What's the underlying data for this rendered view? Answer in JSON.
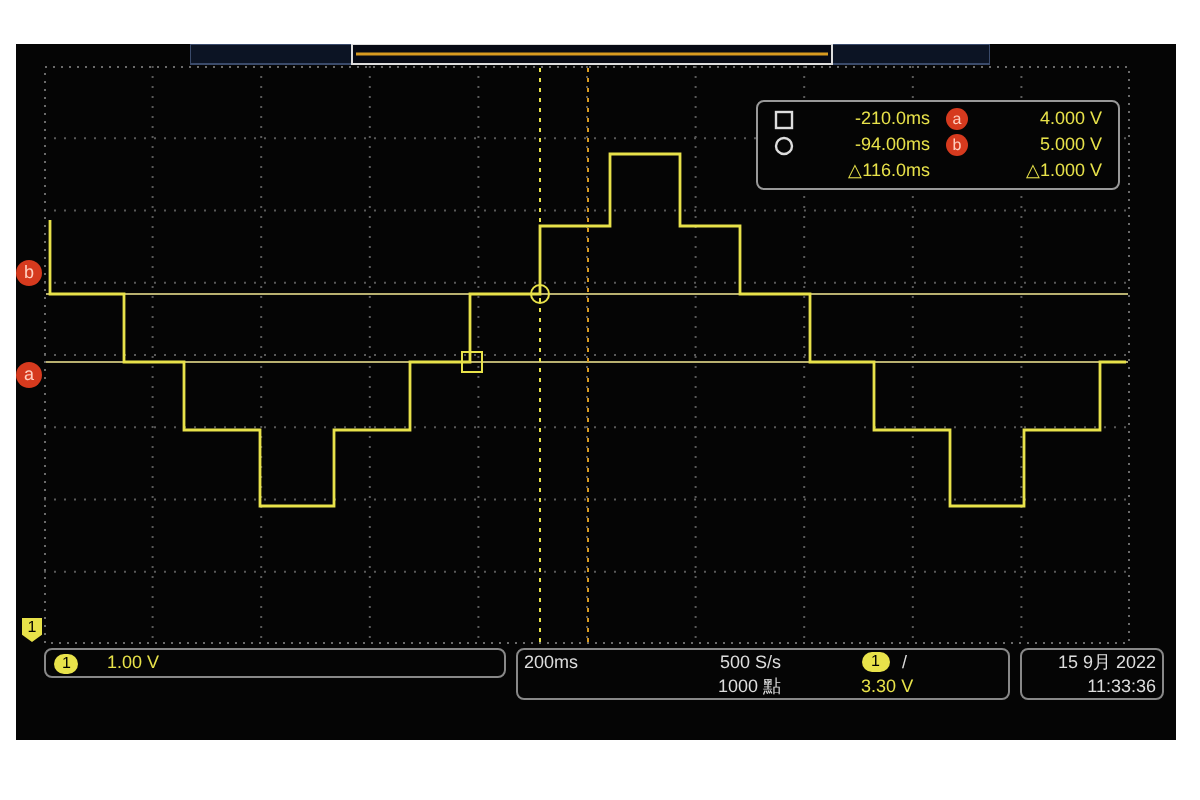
{
  "level_markers": [
    {
      "label": "b",
      "kind": "ref"
    },
    {
      "label": "a",
      "kind": "ref"
    }
  ],
  "channel_marker": {
    "label": "1"
  },
  "cursor_readout": {
    "rows": [
      {
        "kind": "square",
        "time": "-210.0ms",
        "marker": "a",
        "value": "4.000 V"
      },
      {
        "kind": "circle",
        "time": "-94.00ms",
        "marker": "b",
        "value": "5.000 V"
      }
    ],
    "delta_time": "△116.0ms",
    "delta_value": "△1.000 V"
  },
  "channel_box": {
    "channel": "1",
    "scale": "1.00 V"
  },
  "horizontal_box": {
    "time_scale": "200ms",
    "sample_rate": "500 S/s",
    "record_length": "1000 點",
    "trigger_channel": "1",
    "trigger_slope": "/",
    "trigger_level": "3.30 V"
  },
  "datetime": {
    "date": "15 9月 2022",
    "time": "11:33:36"
  }
}
